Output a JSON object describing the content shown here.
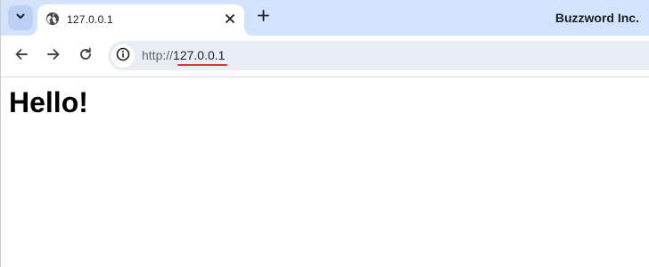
{
  "browser": {
    "brand": "Buzzword Inc.",
    "tab": {
      "title": "127.0.0.1",
      "favicon": "globe-icon"
    },
    "toolbar": {
      "back_icon": "arrow-left-icon",
      "forward_icon": "arrow-right-icon",
      "reload_icon": "reload-icon",
      "site_info_icon": "info-icon"
    },
    "address_bar": {
      "scheme": "http://",
      "host": "127.0.0.1"
    }
  },
  "page": {
    "heading": "Hello!"
  },
  "colors": {
    "tabstrip_bg": "#d3e3fd",
    "omnibox_bg": "#e9eef6",
    "url_underline": "#e0303a"
  }
}
